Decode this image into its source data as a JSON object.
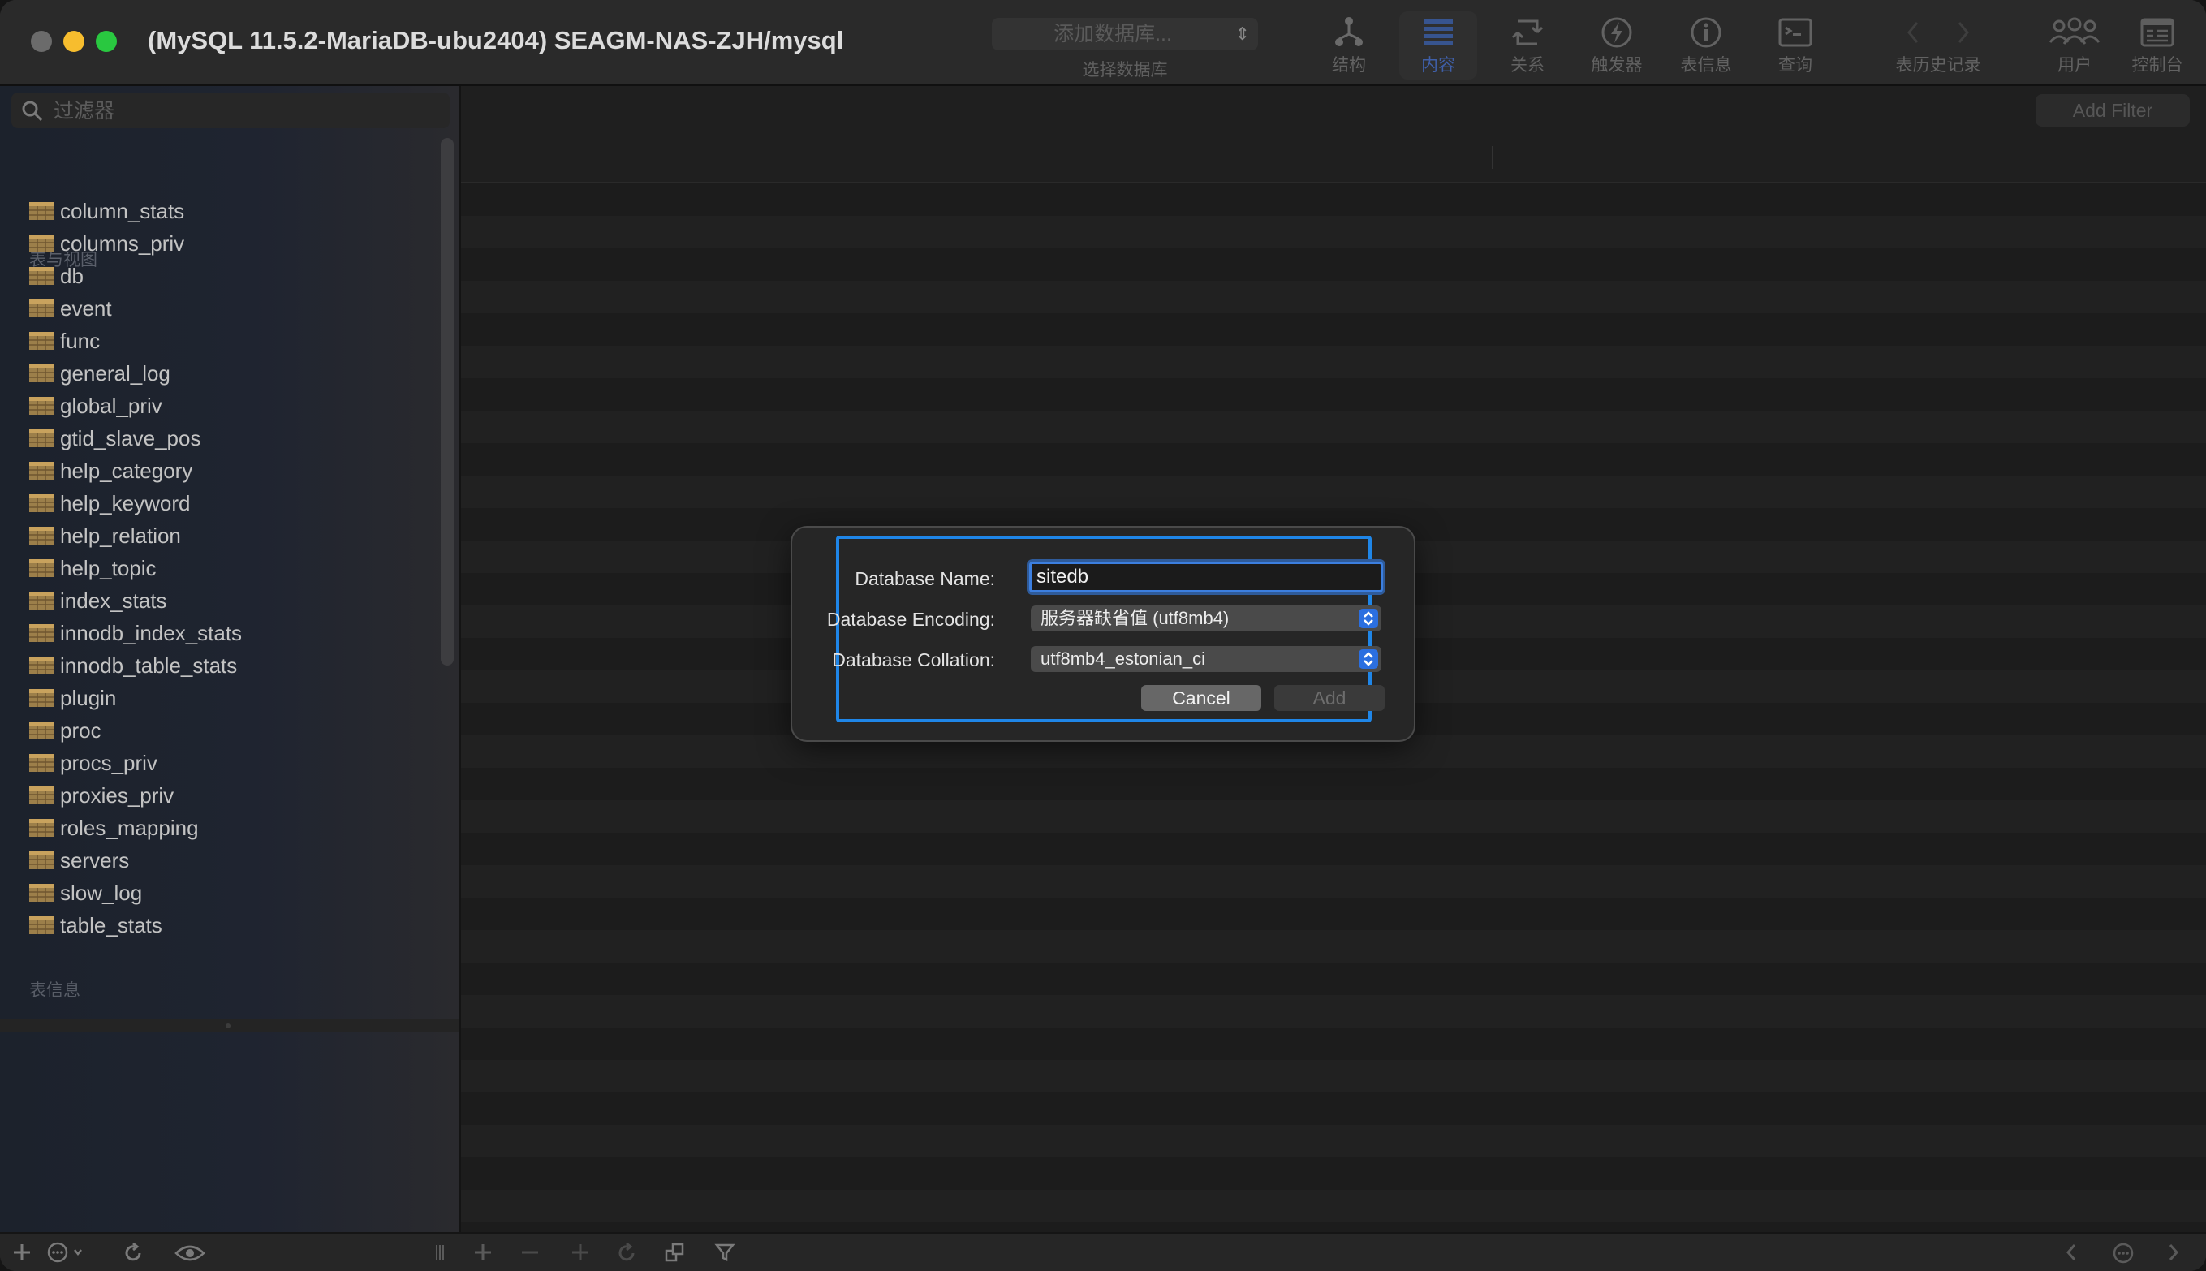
{
  "window": {
    "title": "(MySQL 11.5.2-MariaDB-ubu2404) SEAGM-NAS-ZJH/mysql"
  },
  "toolbar": {
    "db_select_value": "添加数据库...",
    "db_select_label": "选择数据库",
    "buttons": [
      {
        "label": "结构",
        "icon": "structure-icon"
      },
      {
        "label": "内容",
        "icon": "content-icon",
        "active": true
      },
      {
        "label": "关系",
        "icon": "relations-icon"
      },
      {
        "label": "触发器",
        "icon": "triggers-icon"
      },
      {
        "label": "表信息",
        "icon": "info-icon"
      },
      {
        "label": "查询",
        "icon": "query-icon"
      },
      {
        "label": "表历史记录",
        "icon": "history-icon"
      },
      {
        "label": "用户",
        "icon": "users-icon"
      },
      {
        "label": "控制台",
        "icon": "console-icon"
      }
    ]
  },
  "sidebar": {
    "filter_placeholder": "过滤器",
    "section_tables": "表与视图",
    "tables": [
      "column_stats",
      "columns_priv",
      "db",
      "event",
      "func",
      "general_log",
      "global_priv",
      "gtid_slave_pos",
      "help_category",
      "help_keyword",
      "help_relation",
      "help_topic",
      "index_stats",
      "innodb_index_stats",
      "innodb_table_stats",
      "plugin",
      "proc",
      "procs_priv",
      "proxies_priv",
      "roles_mapping",
      "servers",
      "slow_log",
      "table_stats"
    ],
    "section_info": "表信息"
  },
  "main": {
    "add_filter_label": "Add Filter"
  },
  "dialog": {
    "name_label": "Database Name:",
    "name_value": "sitedb",
    "encoding_label": "Database Encoding:",
    "encoding_value": "服务器缺省值 (utf8mb4)",
    "collation_label": "Database Collation:",
    "collation_value": "utf8mb4_estonian_ci",
    "cancel_label": "Cancel",
    "add_label": "Add"
  },
  "colors": {
    "accent": "#1f86e8",
    "traffic_min": "#f7bd2e",
    "traffic_max": "#29c840"
  }
}
